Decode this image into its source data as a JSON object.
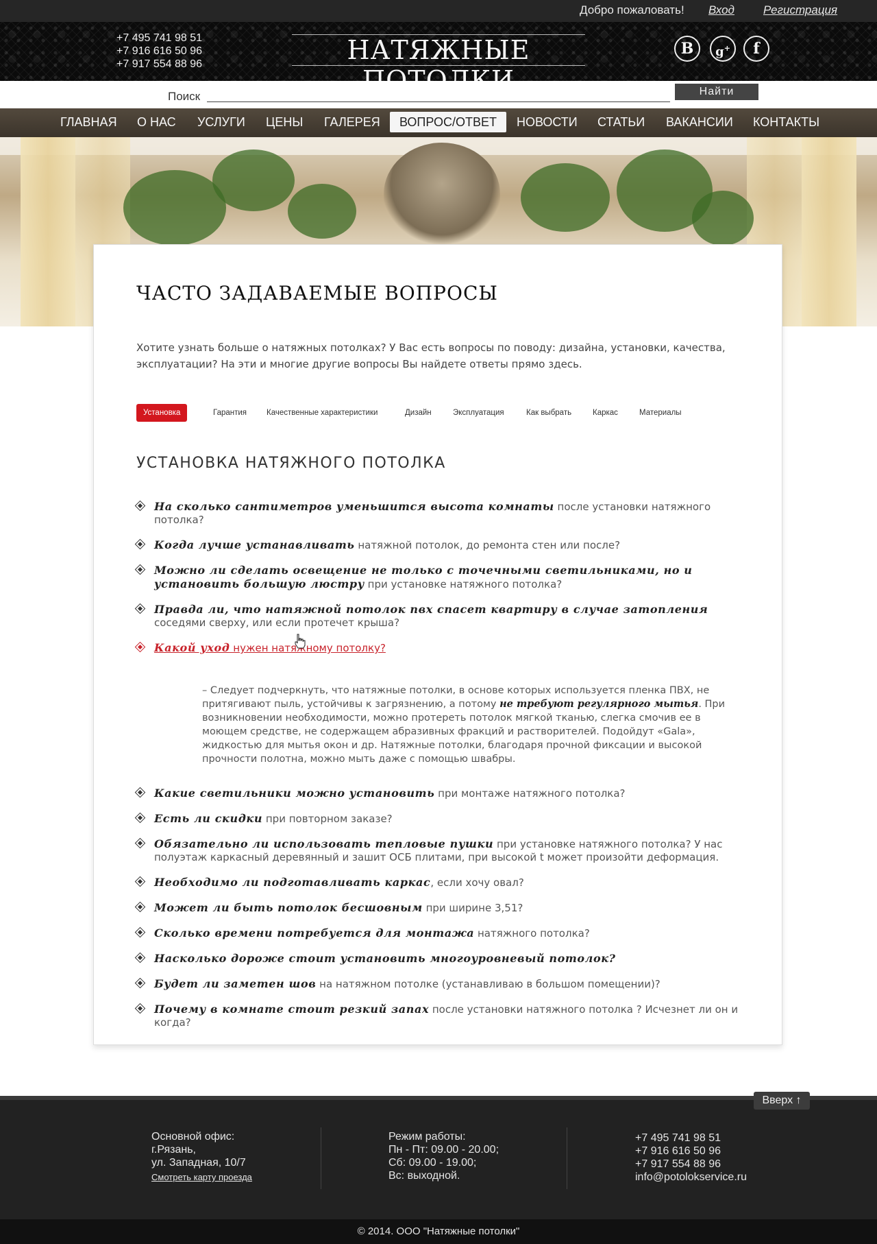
{
  "topbar": {
    "welcome": "Добро пожаловать!",
    "login": "Вход",
    "register": "Регистрация"
  },
  "header": {
    "phones": [
      "+7 495 741 98 51",
      "+7 916 616 50 96",
      "+7 917 554 88 96"
    ],
    "logo": "НАТЯЖНЫЕ ПОТОЛКИ",
    "social": [
      "vk-icon",
      "google-plus-icon",
      "facebook-icon"
    ]
  },
  "search": {
    "label": "Поиск",
    "value": "",
    "button": "Найти"
  },
  "nav": {
    "items": [
      "ГЛАВНАЯ",
      "О НАС",
      "УСЛУГИ",
      "ЦЕНЫ",
      "ГАЛЕРЕЯ",
      "ВОПРОС/ОТВЕТ",
      "НОВОСТИ",
      "СТАТЬИ",
      "ВАКАНСИИ",
      "КОНТАКТЫ"
    ],
    "active": "ВОПРОС/ОТВЕТ"
  },
  "page": {
    "title": "ЧАСТО ЗАДАВАЕМЫЕ ВОПРОСЫ",
    "intro": "Хотите узнать больше о натяжных потолках? У Вас есть вопросы по поводу: дизайна, установки, качества, эксплуатации? На эти и многие другие вопросы Вы найдете ответы прямо здесь.",
    "tabs": [
      "Установка",
      "Гарантия",
      "Качественные характеристики",
      "Дизайн",
      "Эксплуатация",
      "Как выбрать",
      "Каркас",
      "Материалы"
    ],
    "active_tab": "Установка",
    "section_title": "УСТАНОВКА НАТЯЖНОГО ПОТОЛКА"
  },
  "faq": {
    "questions_before": [
      {
        "bold": "На сколько сантиметров уменьшится высота комнаты",
        "rest": " после установки натяжного потолка?"
      },
      {
        "bold": "Когда лучше устанавливать",
        "rest": " натяжной потолок, до ремонта стен или после?"
      },
      {
        "bold": "Можно ли  сделать освещение не только с точечными светильниками, но и установить большую люстру",
        "rest": " при установке натяжного потолка?"
      },
      {
        "bold": "Правда ли, что натяжной потолок пвх спасет квартиру в случае затопления",
        "rest": " соседями сверху, или если протечет крыша?"
      }
    ],
    "open_question": {
      "bold": "Какой уход",
      "rest": " нужен натяжному потолку?"
    },
    "answer": {
      "part1": "– Следует подчеркнуть, что натяжные потолки, в основе которых используется пленка ПВХ, не притягивают пыль, устойчивы к загрязнению, а потому ",
      "bold": "не требуют регулярного мытья",
      "part2": ". При возникновении необходимости, можно протереть потолок мягкой тканью, слегка смочив ее в моющем средстве, не содержащем абразивных фракций и растворителей. Подойдут «Gala», жидкостью для мытья окон и др. Натяжные потолки, благодаря прочной фиксации и высокой прочности полотна, можно мыть даже с помощью швабры."
    },
    "questions_after": [
      {
        "bold": "Какие светильники можно установить",
        "rest": " при монтаже натяжного потолка?"
      },
      {
        "bold": "Есть ли скидки",
        "rest": " при повторном заказе?"
      },
      {
        "bold": "Обязательно ли использовать тепловые пушки",
        "rest": " при установке натяжного потолка?  У нас полуэтаж каркасный деревянный и зашит ОСБ плитами, при высокой t может произойти деформация."
      },
      {
        "bold": "Необходимо ли подготавливать каркас",
        "rest": ", если хочу овал?"
      },
      {
        "bold": "Может ли быть потолок бесшовным",
        "rest": " при ширине 3,51?"
      },
      {
        "bold": "Сколько времени потребуется для монтажа",
        "rest": " натяжного потолка?"
      },
      {
        "bold": "Насколько дороже стоит установить многоуровневый потолок?",
        "rest": ""
      },
      {
        "bold": "Будет ли заметен шов",
        "rest": " на натяжном потолке (устанавливаю в большом помещении)?"
      },
      {
        "bold": "Почему в комнате стоит резкий запах",
        "rest": " после установки натяжного потолка ? Исчезнет ли он и когда?"
      }
    ]
  },
  "footer": {
    "up": "Вверх ↑",
    "office": {
      "lines": [
        "Основной офис:",
        "г.Рязань,",
        "ул. Западная, 10/7"
      ],
      "map_link": "Смотреть карту проезда"
    },
    "hours": {
      "lines": [
        "Режим работы:",
        "Пн - Пт: 09.00 - 20.00;",
        "Сб: 09.00 - 19.00;",
        "Вс: выходной."
      ]
    },
    "contacts": {
      "lines": [
        "+7 495 741 98 51",
        "+7 916 616 50 96",
        "+7 917 554 88 96",
        "info@potolokservice.ru"
      ]
    },
    "copyright": "© 2014. ООО \"Натяжные потолки\""
  }
}
